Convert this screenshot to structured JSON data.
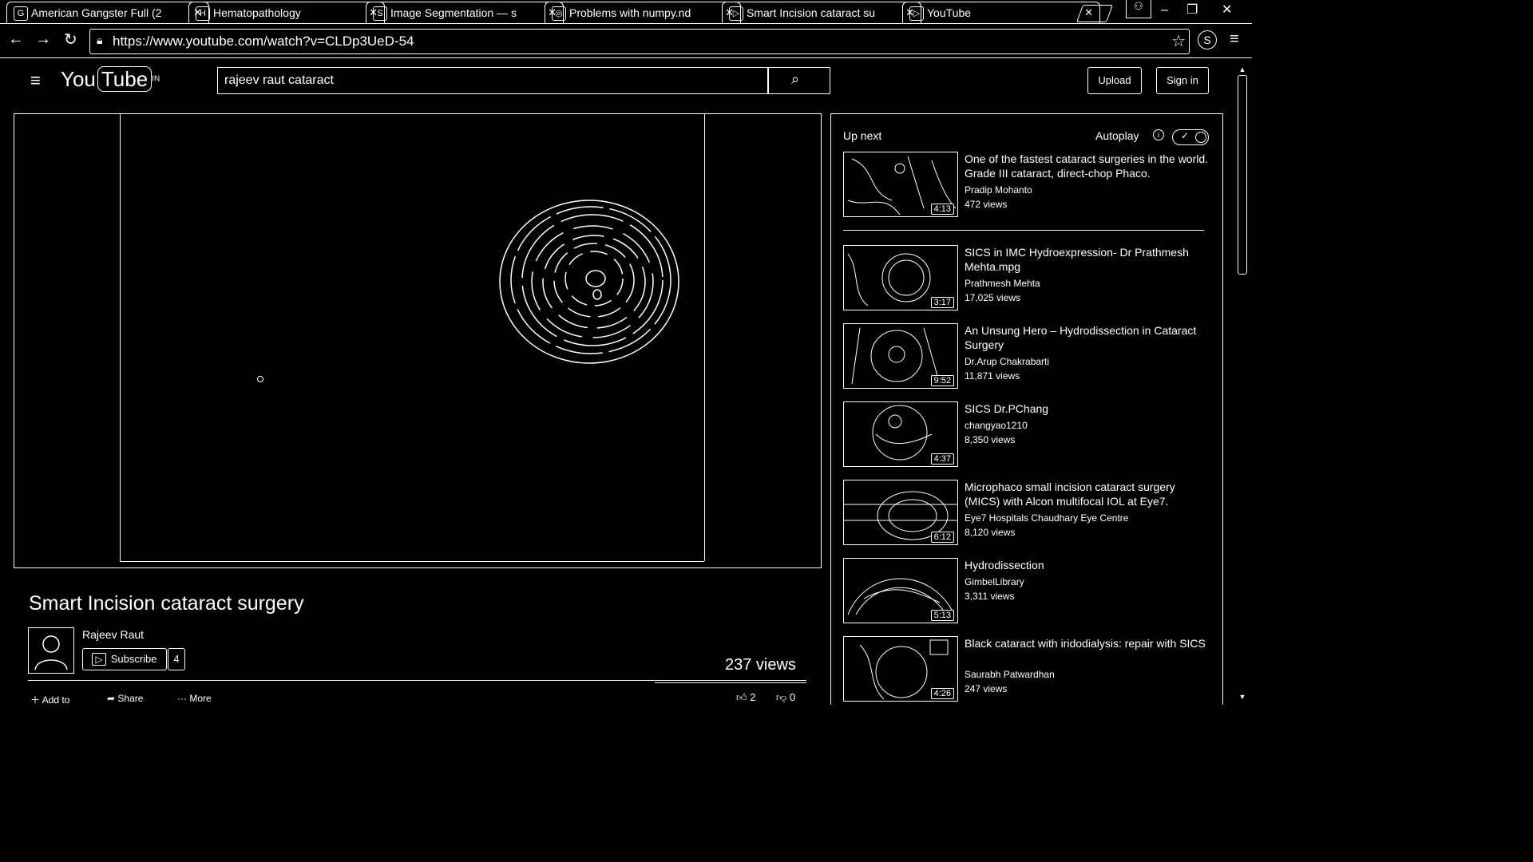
{
  "tabs": [
    {
      "icon": "G",
      "title": "American Gangster Full (2"
    },
    {
      "icon": "H",
      "title": "Hematopathology"
    },
    {
      "icon": "S",
      "title": "Image Segmentation — s"
    },
    {
      "icon": "◎",
      "title": "Problems with numpy.nd"
    },
    {
      "icon": "▷",
      "title": "Smart Incision cataract su"
    },
    {
      "icon": "▷",
      "title": "YouTube"
    }
  ],
  "browser": {
    "url": "https://www.youtube.com/watch?v=CLDp3UeD-54"
  },
  "header": {
    "logo_you": "You",
    "logo_tube": "Tube",
    "region": "IN",
    "search_value": "rajeev raut cataract",
    "upload": "Upload",
    "signin": "Sign in"
  },
  "video": {
    "title": "Smart Incision cataract surgery",
    "channel": "Rajeev Raut",
    "subscribe": "Subscribe",
    "sub_count": "4",
    "views": "237 views",
    "add_to": "Add to",
    "share": "Share",
    "more": "More",
    "likes": "2",
    "dislikes": "0"
  },
  "sidebar": {
    "up_next": "Up next",
    "autoplay": "Autoplay",
    "info": "i",
    "items": [
      {
        "title": "One of the fastest cataract surgeries in the world. Grade III cataract, direct-chop Phaco.",
        "channel": "Pradip Mohanto",
        "views": "472 views",
        "duration": "4:13"
      },
      {
        "title": "SICS in IMC Hydroexpression- Dr Prathmesh Mehta.mpg",
        "channel": "Prathmesh Mehta",
        "views": "17,025 views",
        "duration": "3:17"
      },
      {
        "title": "An Unsung Hero – Hydrodissection in Cataract Surgery",
        "channel": "Dr.Arup Chakrabarti",
        "views": "11,871 views",
        "duration": "9:52"
      },
      {
        "title": "SICS Dr.PChang",
        "channel": "changyao1210",
        "views": "8,350 views",
        "duration": "4:37"
      },
      {
        "title": "Microphaco small incision cataract surgery (MICS) with Alcon multifocal IOL at Eye7.",
        "channel": "Eye7 Hospitals Chaudhary Eye Centre",
        "views": "8,120 views",
        "duration": "6:12"
      },
      {
        "title": "Hydrodissection",
        "channel": "GimbelLibrary",
        "views": "3,311 views",
        "duration": "5:13"
      },
      {
        "title": "Black cataract with iridodialysis: repair with SICS",
        "channel": "Saurabh Patwardhan",
        "views": "247 views",
        "duration": "4:26"
      }
    ]
  }
}
